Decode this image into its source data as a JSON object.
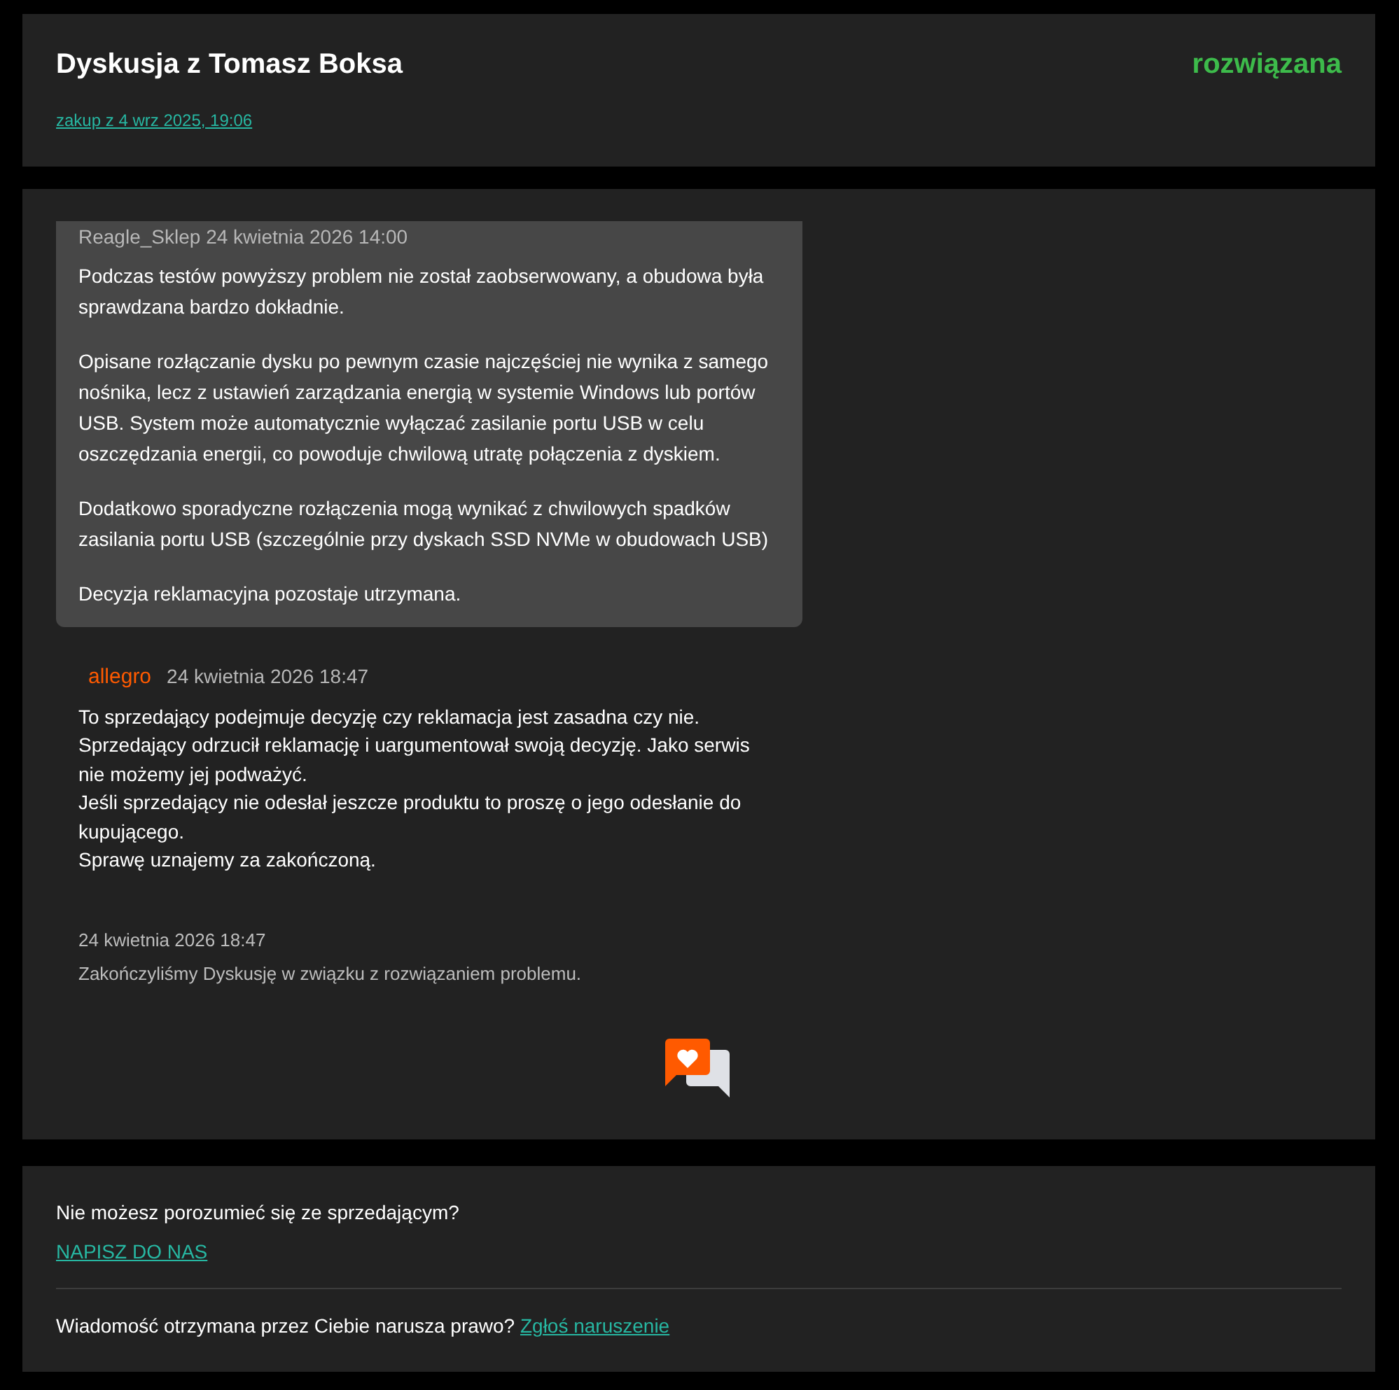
{
  "header": {
    "title": "Dyskusja z Tomasz Boksa",
    "status": "rozwiązana",
    "purchase_link": "zakup z 4 wrz 2025, 19:06"
  },
  "messages": [
    {
      "kind": "seller",
      "author": "Reagle_Sklep",
      "time": "24 kwietnia 2026 14:00",
      "paragraphs": [
        "Podczas testów powyższy problem nie został zaobserwowany, a obudowa była sprawdzana bardzo dokładnie.",
        "Opisane rozłączanie dysku po pewnym czasie najczęściej nie wynika z samego nośnika, lecz z ustawień zarządzania energią w systemie Windows lub portów USB. System może automatycznie wyłączać zasilanie portu USB w celu oszczędzania energii, co powoduje chwilową utratę połączenia z dyskiem.",
        "Dodatkowo sporadyczne rozłączenia mogą wynikać z chwilowych spadków zasilania portu USB (szczególnie przy dyskach SSD NVMe w obudowach USB)",
        "Decyzja reklamacyjna pozostaje utrzymana."
      ]
    },
    {
      "kind": "platform",
      "author": "allegro",
      "time": "24 kwietnia 2026 18:47",
      "paragraphs": [
        "To sprzedający podejmuje decyzję czy reklamacja jest zasadna czy nie.",
        "Sprzedający odrzucił reklamację i uargumentował swoją decyzję. Jako serwis nie możemy jej podważyć.",
        "Jeśli sprzedający nie odesłał jeszcze produktu to proszę o jego odesłanie do kupującego.",
        "Sprawę uznajemy za zakończoną."
      ]
    },
    {
      "kind": "system",
      "time": "24 kwietnia 2026 18:47",
      "paragraphs": [
        "Zakończyliśmy Dyskusję w związku z rozwiązaniem problemu."
      ]
    }
  ],
  "footer": {
    "question": "Nie możesz porozumieć się ze sprzedającym?",
    "contact_link": "NAPISZ DO NAS",
    "report_text": "Wiadomość otrzymana przez Ciebie narusza prawo?",
    "report_link": "Zgłoś naruszenie"
  }
}
